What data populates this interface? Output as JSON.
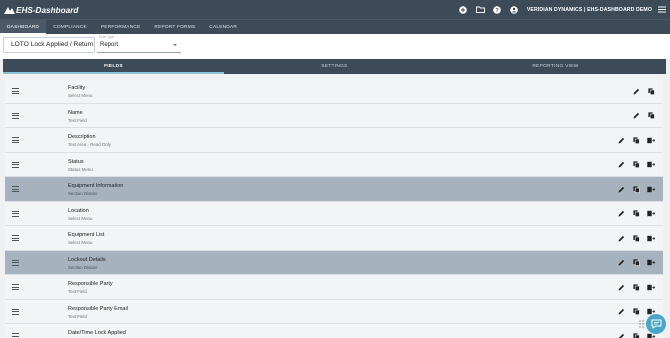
{
  "app": {
    "logo_text": "EHS-Dashboard",
    "org": "VERIDIAN DYNAMICS | EHS-DASHBOARD DEMO"
  },
  "top_icons": [
    "add-circle-icon",
    "folder-icon",
    "help-icon",
    "account-icon",
    "menu-icon"
  ],
  "nav": {
    "tabs": [
      "DASHBOARD",
      "COMPLIANCE",
      "PERFORMANCE",
      "REPORT FORMS",
      "CALENDAR"
    ],
    "active": "DASHBOARD"
  },
  "form": {
    "title": "LOTO Lock Applied / Return to Service",
    "type_label": "Form Type",
    "type_value": "Report"
  },
  "subtabs": [
    "FIELDS",
    "SETTINGS",
    "REPORTING VIEW"
  ],
  "fields": [
    {
      "name": "Facility",
      "type": "Select Menu"
    },
    {
      "name": "Name",
      "type": "Text Field"
    },
    {
      "name": "Description",
      "type": "Text Area - Read Only"
    },
    {
      "name": "Status",
      "type": "Status Menu"
    },
    {
      "name": "Equipment Information",
      "type": "Section Divider"
    },
    {
      "name": "Location",
      "type": "Select Menu"
    },
    {
      "name": "Equipment List",
      "type": "Select Menu"
    },
    {
      "name": "Lockout Details",
      "type": "Section Divider"
    },
    {
      "name": "Responsible Party",
      "type": "Text Field"
    },
    {
      "name": "Responsible Party Email",
      "type": "Text Field"
    },
    {
      "name": "Date/Time Lock Applied",
      "type": ""
    }
  ],
  "colors": {
    "header": "#3d4a58",
    "divider_row": "#a6b2bd",
    "row": "#f3f4f6",
    "chat": "#4aa7c8"
  }
}
